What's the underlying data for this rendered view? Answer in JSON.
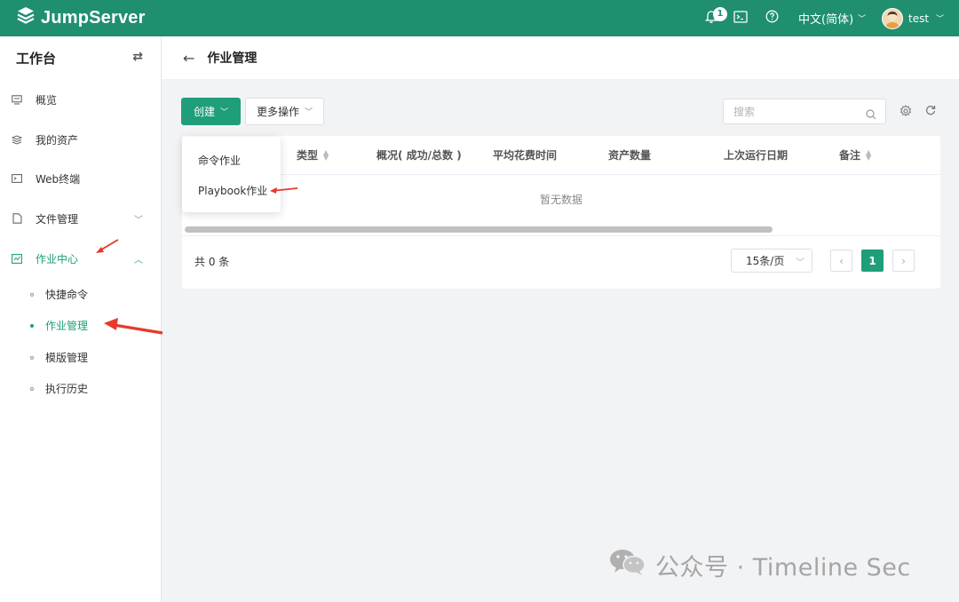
{
  "app": {
    "name": "JumpServer"
  },
  "header": {
    "notification_count": "1",
    "language": "中文(简体)",
    "user": "test",
    "icons": [
      "bell-icon",
      "terminal-icon",
      "help-icon",
      "avatar"
    ]
  },
  "sidebar": {
    "title": "工作台",
    "items": [
      {
        "label": "概览",
        "icon": "monitor-icon"
      },
      {
        "label": "我的资产",
        "icon": "layers-icon"
      },
      {
        "label": "Web终端",
        "icon": "terminal-icon"
      },
      {
        "label": "文件管理",
        "icon": "file-icon",
        "expandable": true
      },
      {
        "label": "作业中心",
        "icon": "job-icon",
        "expanded": true,
        "active": true
      }
    ],
    "subitems": [
      {
        "label": "快捷命令"
      },
      {
        "label": "作业管理",
        "active": true
      },
      {
        "label": "模版管理"
      },
      {
        "label": "执行历史"
      }
    ]
  },
  "page": {
    "title": "作业管理"
  },
  "toolbar": {
    "create_label": "创建",
    "more_label": "更多操作",
    "search_placeholder": "搜索"
  },
  "create_menu": {
    "items": [
      "命令作业",
      "Playbook作业"
    ]
  },
  "table": {
    "columns": [
      "类型",
      "概况( 成功/总数 )",
      "平均花费时间",
      "资产数量",
      "上次运行日期",
      "备注"
    ],
    "empty_text": "暂无数据"
  },
  "pagination": {
    "total_label": "共 0 条",
    "page_size": "15条/页",
    "current_page": "1"
  },
  "watermark": "公众号 · Timeline Sec",
  "colors": {
    "brand": "#1f8f70",
    "accent": "#1f9e7a",
    "annotation": "#e8392a"
  }
}
